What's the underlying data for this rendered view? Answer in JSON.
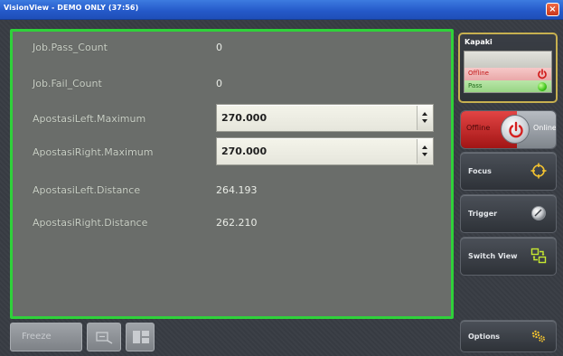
{
  "window": {
    "title": "VisionView - DEMO ONLY (37:56)",
    "close_glyph": "×"
  },
  "rows": [
    {
      "label": "Job.Pass_Count",
      "value": "0"
    },
    {
      "label": "Job.Fail_Count",
      "value": "0"
    },
    {
      "label": "ApostasiLeft.Maximum",
      "value": "270.000"
    },
    {
      "label": "ApostasiRight.Maximum",
      "value": "270.000"
    },
    {
      "label": "ApostasiLeft.Distance",
      "value": "264.193"
    },
    {
      "label": "ApostasiRight.Distance",
      "value": "262.210"
    }
  ],
  "kapaki": {
    "title": "Kapaki",
    "offline_label": "Offline",
    "pass_label": "Pass"
  },
  "toggle": {
    "offline_label": "Offline",
    "online_label": "Online"
  },
  "sidebar": {
    "focus_label": "Focus",
    "trigger_label": "Trigger",
    "switch_view_label": "Switch View",
    "options_label": "Options"
  },
  "bottom": {
    "freeze_label": "Freeze"
  },
  "colors": {
    "panel_border": "#2fd13a",
    "kapaki_border": "#c7b050",
    "offline_red": "#c21515",
    "pass_green": "#3ec51a",
    "titlebar_blue": "#2458c8"
  },
  "icons": {
    "close": "close-icon",
    "power": "power-icon",
    "status": "status-light-icon",
    "focus": "crosshair-icon",
    "trigger": "trigger-icon",
    "switch_view": "switch-view-icon",
    "options": "gear-icon",
    "spin": "spinner-arrows-icon"
  }
}
